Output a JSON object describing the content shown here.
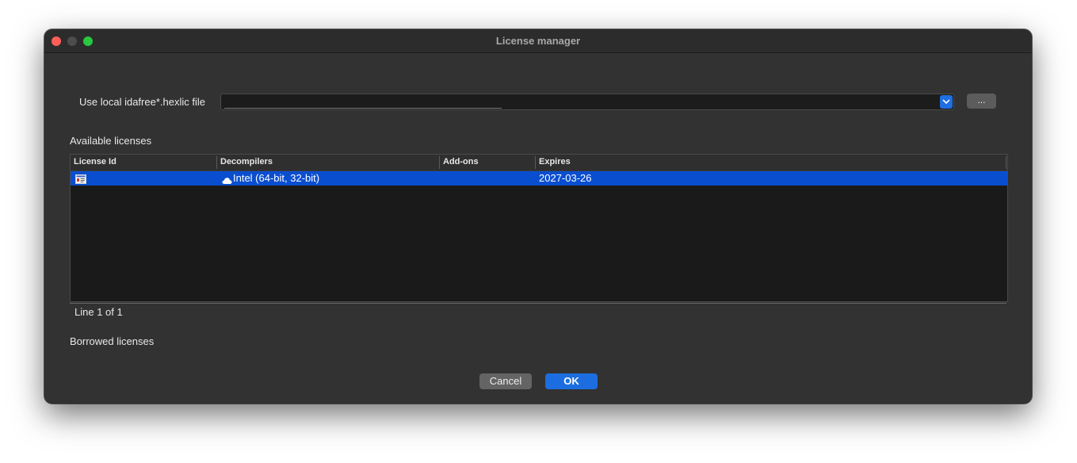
{
  "window": {
    "title": "License manager"
  },
  "local_file": {
    "label": "Use local idafree*.hexlic file",
    "value": "",
    "browse_label": "..."
  },
  "available": {
    "heading": "Available licenses",
    "columns": [
      "License Id",
      "Decompilers",
      "Add-ons",
      "Expires"
    ],
    "rows": [
      {
        "license_id": "",
        "license_icon": "license-card-icon",
        "decompilers_icon": "cloud-icon",
        "decompilers": "Intel (64-bit, 32-bit)",
        "addons": "",
        "expires": "2027-03-26"
      }
    ],
    "status": "Line 1 of 1"
  },
  "borrowed": {
    "heading": "Borrowed licenses"
  },
  "buttons": {
    "cancel": "Cancel",
    "ok": "OK"
  },
  "colors": {
    "selection": "#0a4ed0",
    "accent": "#1c6ee0",
    "close": "#fe5f57",
    "maximize": "#28c840"
  }
}
